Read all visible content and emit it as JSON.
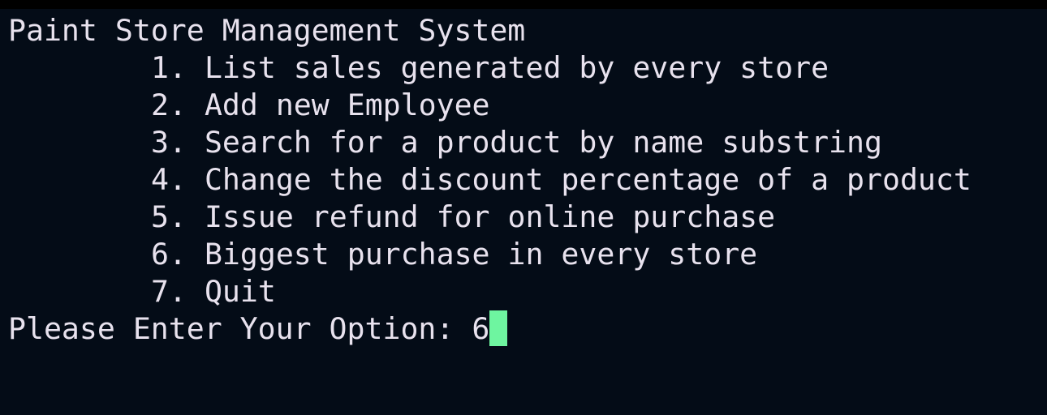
{
  "title": "Paint Store Management System",
  "menu": [
    {
      "number": "1.",
      "label": "List sales generated by every store"
    },
    {
      "number": "2.",
      "label": "Add new Employee"
    },
    {
      "number": "3.",
      "label": "Search for a product by name substring"
    },
    {
      "number": "4.",
      "label": "Change the discount percentage of a product"
    },
    {
      "number": "5.",
      "label": "Issue refund for online purchase"
    },
    {
      "number": "6.",
      "label": "Biggest purchase in every store"
    },
    {
      "number": "7.",
      "label": "Quit"
    }
  ],
  "prompt": {
    "label": "Please Enter Your Option: ",
    "input_value": "6"
  },
  "colors": {
    "background": "#040c17",
    "text": "#e8e2ee",
    "cursor": "#6ef5a0"
  }
}
